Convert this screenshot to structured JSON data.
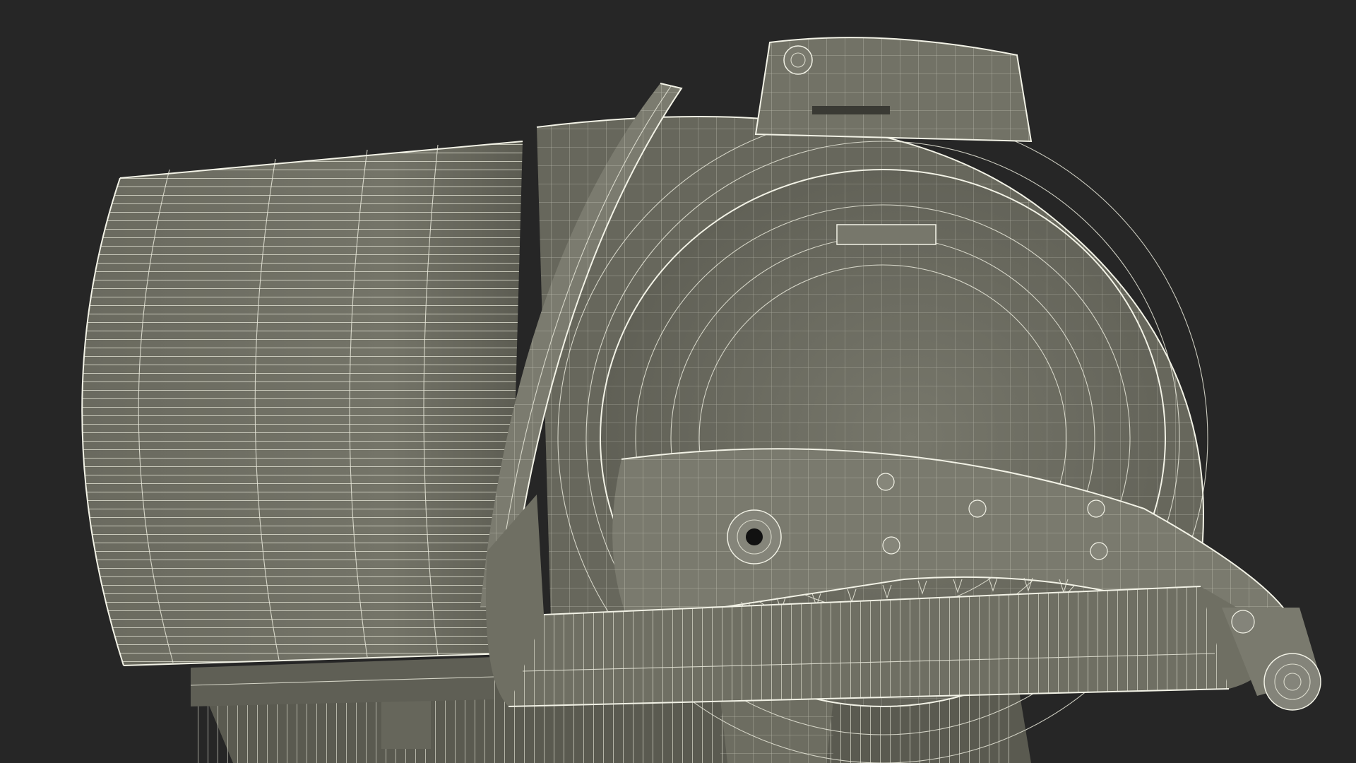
{
  "scene": {
    "background_color": "#262626",
    "mesh_color": "#6e6e62",
    "mesh_shadow_color": "#55554b",
    "wire_color": "#e9e9da"
  }
}
